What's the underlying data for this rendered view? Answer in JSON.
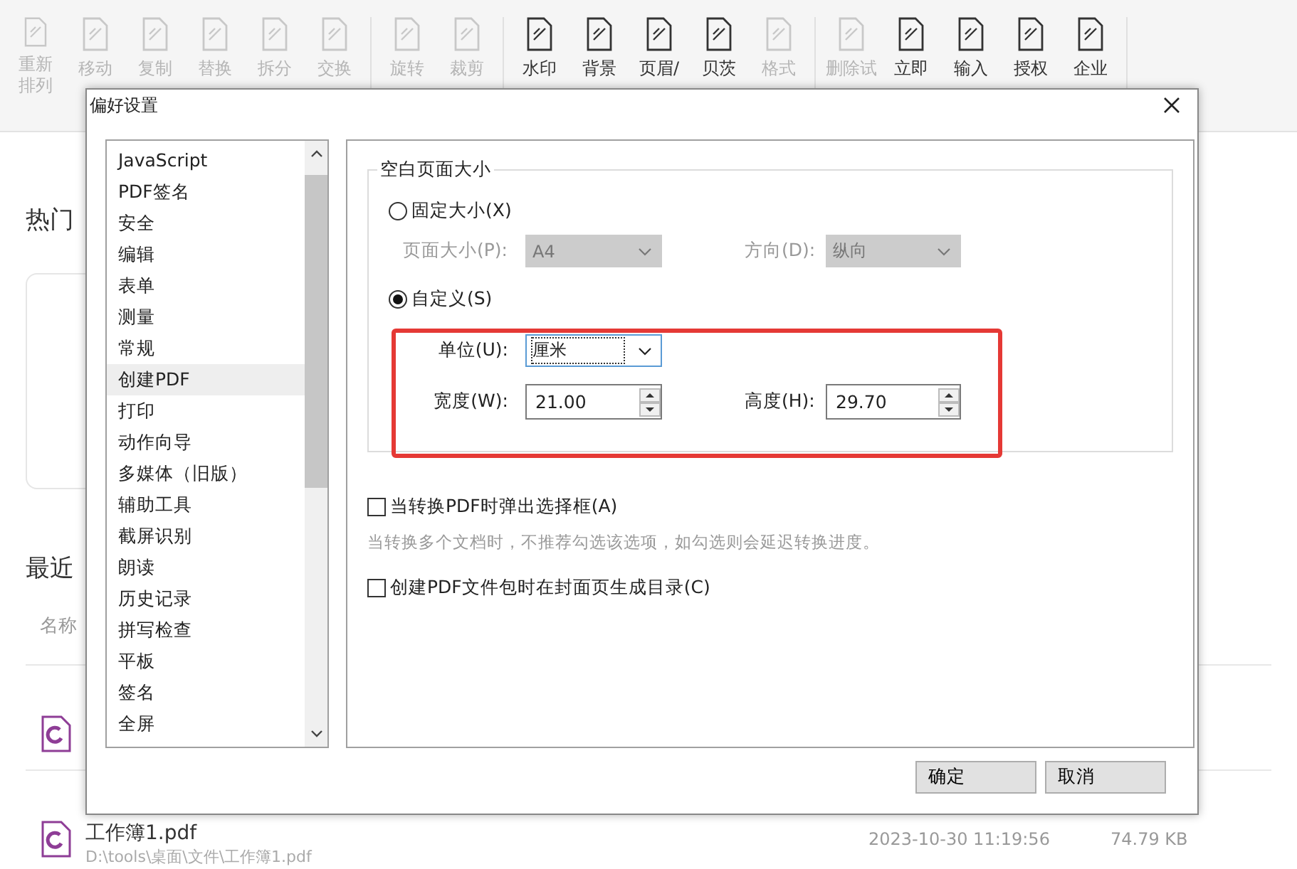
{
  "toolbar": {
    "groups": [
      {
        "items": [
          {
            "lines": [
              "重新",
              "排列"
            ],
            "disabled": true
          },
          {
            "label": "移动",
            "disabled": true
          },
          {
            "label": "复制",
            "disabled": true
          },
          {
            "label": "替换",
            "disabled": true
          },
          {
            "label": "拆分",
            "disabled": true
          },
          {
            "label": "交换",
            "disabled": true
          }
        ]
      },
      {
        "items": [
          {
            "label": "旋转",
            "disabled": true
          },
          {
            "label": "裁剪",
            "disabled": true
          }
        ]
      },
      {
        "items": [
          {
            "label": "水印",
            "disabled": false
          },
          {
            "label": "背景",
            "disabled": false
          },
          {
            "label": "页眉/",
            "disabled": false
          },
          {
            "label": "贝茨",
            "disabled": false
          },
          {
            "label": "格式",
            "disabled": true
          }
        ]
      },
      {
        "items": [
          {
            "label": "删除试",
            "disabled": true
          },
          {
            "label": "立即",
            "disabled": false
          },
          {
            "label": "输入",
            "disabled": false
          },
          {
            "label": "授权",
            "disabled": false
          },
          {
            "label": "企业",
            "disabled": false
          }
        ]
      }
    ]
  },
  "home": {
    "hot_tools_title": "热门",
    "recent_title": "最近",
    "name_column": "名称",
    "files": [
      {
        "kind": "pdf"
      },
      {
        "kind": "pdf",
        "name": "工作簿1.pdf",
        "path": "D:\\tools\\桌面\\文件\\工作簿1.pdf",
        "date": "2023-10-30 11:19:56",
        "size": "74.79 KB"
      }
    ]
  },
  "dialog": {
    "title": "偏好设置",
    "categories": [
      {
        "label": "JavaScript",
        "selected": false
      },
      {
        "label": "PDF签名",
        "selected": false
      },
      {
        "label": "安全",
        "selected": false
      },
      {
        "label": "编辑",
        "selected": false
      },
      {
        "label": "表单",
        "selected": false
      },
      {
        "label": "测量",
        "selected": false
      },
      {
        "label": "常规",
        "selected": false
      },
      {
        "label": "创建PDF",
        "selected": true
      },
      {
        "label": "打印",
        "selected": false
      },
      {
        "label": "动作向导",
        "selected": false
      },
      {
        "label": "多媒体（旧版）",
        "selected": false
      },
      {
        "label": "辅助工具",
        "selected": false
      },
      {
        "label": "截屏识别",
        "selected": false
      },
      {
        "label": "朗读",
        "selected": false
      },
      {
        "label": "历史记录",
        "selected": false
      },
      {
        "label": "拼写检查",
        "selected": false
      },
      {
        "label": "平板",
        "selected": false
      },
      {
        "label": "签名",
        "selected": false
      },
      {
        "label": "全屏",
        "selected": false
      }
    ],
    "page_size_group": {
      "title": "空白页面大小",
      "fixed_option": {
        "label": "固定大小(X)",
        "selected": false
      },
      "page_size": {
        "label": "页面大小(P):",
        "value": "A4",
        "disabled": true
      },
      "orientation": {
        "label": "方向(D):",
        "value": "纵向",
        "disabled": true
      },
      "custom_option": {
        "label": "自定义(S)",
        "selected": true
      },
      "unit": {
        "label": "单位(U):",
        "value": "厘米"
      },
      "width": {
        "label": "宽度(W):",
        "value": "21.00"
      },
      "height": {
        "label": "高度(H):",
        "value": "29.70"
      }
    },
    "options": [
      {
        "label": "当转换PDF时弹出选择框(A)",
        "checked": false,
        "note": "当转换多个文档时，不推荐勾选该选项，如勾选则会延迟转换进度。"
      },
      {
        "label": "创建PDF文件包时在封面页生成目录(C)",
        "checked": false
      }
    ],
    "buttons": [
      "确定",
      "取消"
    ]
  }
}
